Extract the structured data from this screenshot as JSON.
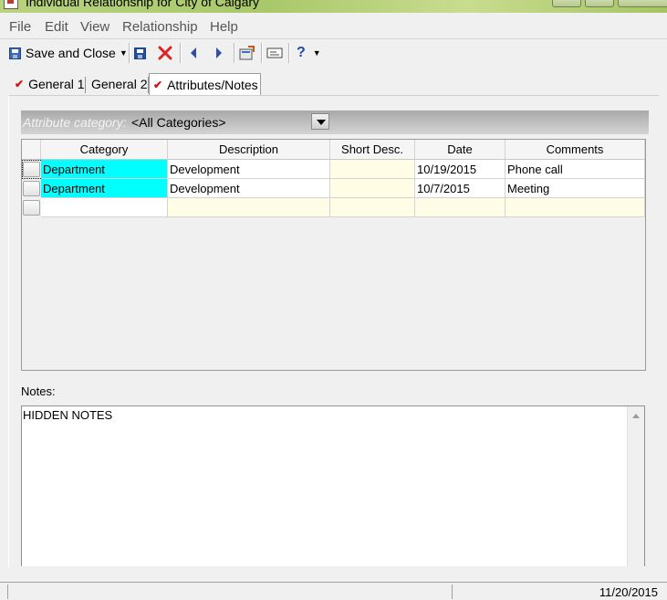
{
  "window": {
    "title": "Individual Relationship for City of Calgary",
    "title_color": "#a9c86a"
  },
  "menu": [
    "File",
    "Edit",
    "View",
    "Relationship",
    "Help"
  ],
  "toolbar": {
    "save_close_label": "Save and Close",
    "icons": [
      "save-icon",
      "delete-icon",
      "previous-icon",
      "next-icon",
      "properties-icon",
      "card-icon",
      "help-icon"
    ],
    "help_label": "?"
  },
  "tabs": [
    {
      "label": "General 1",
      "checked": true
    },
    {
      "label": "General 2",
      "checked": false
    },
    {
      "label": "Attributes/Notes",
      "checked": true,
      "active": true
    }
  ],
  "attribute_category": {
    "label": "Attribute category:",
    "value": "<All Categories>"
  },
  "grid": {
    "columns": [
      "Category",
      "Description",
      "Short Desc.",
      "Date",
      "Comments"
    ],
    "rows": [
      {
        "category": "Department",
        "description": "Development",
        "short_desc": "",
        "date": "10/19/2015",
        "comments": "Phone call"
      },
      {
        "category": "Department",
        "description": "Development",
        "short_desc": "",
        "date": "10/7/2015",
        "comments": "Meeting"
      }
    ],
    "category_color": "#00ffff"
  },
  "notes": {
    "label": "Notes:",
    "text": "HIDDEN NOTES"
  },
  "status": {
    "date": "11/20/2015"
  }
}
